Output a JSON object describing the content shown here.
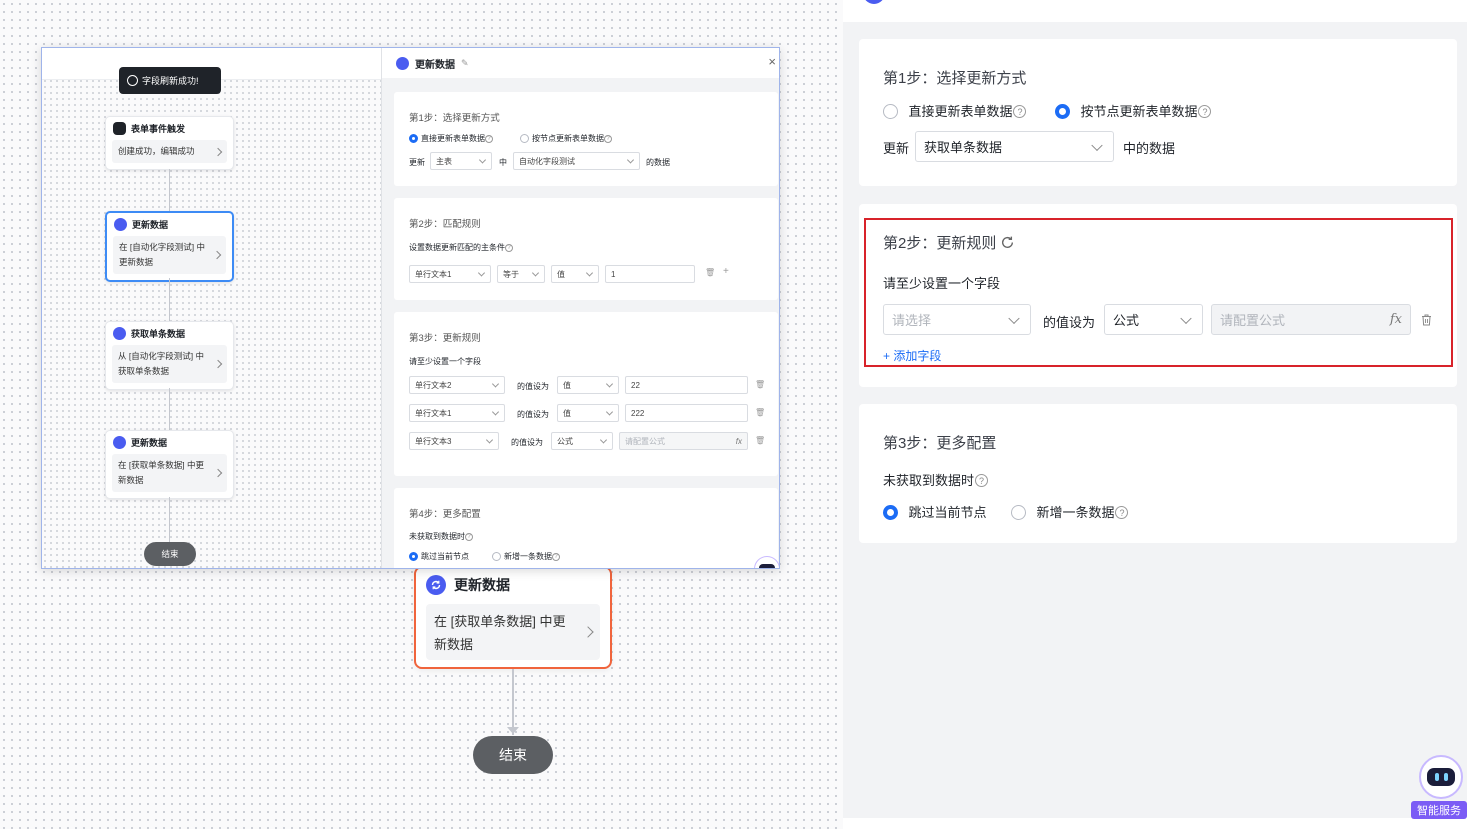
{
  "canvas": {
    "node": {
      "title": "更新数据",
      "body": "在 [获取单条数据] 中更新数据"
    },
    "end_label": "结束"
  },
  "right_panel": {
    "step1": {
      "title": "第1步：选择更新方式",
      "option_direct": "直接更新表单数据",
      "option_by_node": "按节点更新表单数据",
      "selected": "按节点更新表单数据",
      "update_label": "更新",
      "source_value": "获取单条数据",
      "suffix": "中的数据"
    },
    "step2": {
      "title": "第2步：更新规则",
      "hint": "请至少设置一个字段",
      "field_placeholder": "请选择",
      "value_as": "的值设为",
      "value_type": "公式",
      "formula_placeholder": "请配置公式",
      "fx": "fx",
      "add_field": "+ 添加字段"
    },
    "step3": {
      "title": "第3步：更多配置",
      "no_data_label": "未获取到数据时",
      "option_skip": "跳过当前节点",
      "option_add": "新增一条数据",
      "selected": "跳过当前节点"
    }
  },
  "bot": {
    "label": "智能服务"
  },
  "mini": {
    "toast": "字段刷新成功!",
    "nodes": [
      {
        "title": "表单事件触发",
        "body": "创建成功，编辑成功"
      },
      {
        "title": "更新数据",
        "body": "在 [自动化字段测试] 中更新数据"
      },
      {
        "title": "获取单条数据",
        "body": "从 [自动化字段测试] 中获取单条数据"
      },
      {
        "title": "更新数据",
        "body": "在 [获取单条数据] 中更新数据"
      }
    ],
    "end_label": "结束",
    "panel": {
      "title": "更新数据",
      "close": "×",
      "step1": {
        "title": "第1步：选择更新方式",
        "option_direct": "直接更新表单数据",
        "option_by_node": "按节点更新表单数据",
        "update_label": "更新",
        "table": "主表",
        "in_label": "中",
        "source": "自动化字段测试",
        "suffix": "的数据"
      },
      "step2": {
        "title": "第2步：匹配规则",
        "hint": "设置数据更新匹配的主条件",
        "field": "单行文本1",
        "op": "等于",
        "type": "值",
        "value": "1"
      },
      "step3": {
        "title": "第3步：更新规则",
        "hint": "请至少设置一个字段",
        "rows": [
          {
            "field": "单行文本2",
            "value_as": "的值设为",
            "type": "值",
            "value": "22"
          },
          {
            "field": "单行文本1",
            "value_as": "的值设为",
            "type": "值",
            "value": "222"
          },
          {
            "field": "单行文本3",
            "value_as": "的值设为",
            "type": "公式",
            "value": "请配置公式"
          }
        ]
      },
      "step4": {
        "title": "第4步：更多配置",
        "no_data_label": "未获取到数据时",
        "option_skip": "跳过当前节点",
        "option_add": "新增一条数据"
      }
    }
  }
}
